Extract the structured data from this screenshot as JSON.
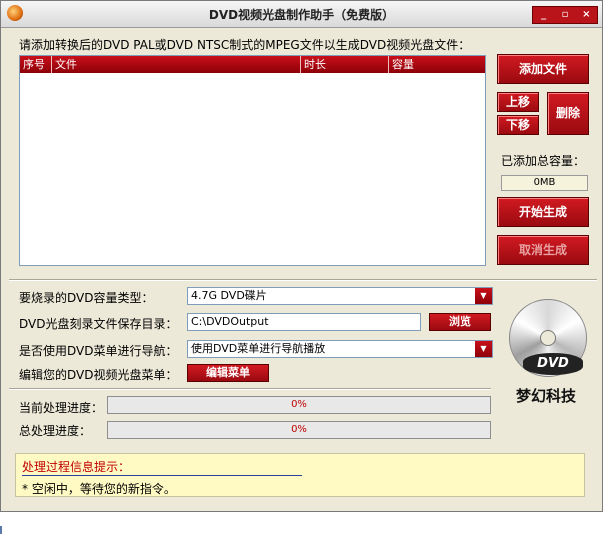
{
  "window": {
    "title": "DVD视频光盘制作助手（免费版）",
    "controls": {
      "minimize": "_",
      "restore": "▫",
      "close": "×"
    }
  },
  "instructions": "请添加转换后的DVD PAL或DVD NTSC制式的MPEG文件以生成DVD视频光盘文件：",
  "file_list": {
    "columns": [
      "序号",
      "文件",
      "时长",
      "容量"
    ],
    "rows": []
  },
  "buttons": {
    "add_file": "添加文件",
    "move_up": "上移",
    "move_down": "下移",
    "delete": "删除",
    "start": "开始生成",
    "cancel": "取消生成",
    "browse": "浏览",
    "edit_menu": "编辑菜单"
  },
  "capacity": {
    "label": "已添加总容量：",
    "value": "0MB"
  },
  "settings": {
    "dvd_type_label": "要烧录的DVD容量类型：",
    "dvd_type_value": "4.7G DVD碟片",
    "save_dir_label": "DVD光盘刻录文件保存目录：",
    "save_dir_value": "C:\\DVDOutput",
    "menu_nav_label": "是否使用DVD菜单进行导航：",
    "menu_nav_value": "使用DVD菜单进行导航播放",
    "edit_menu_label": "编辑您的DVD视频光盘菜单："
  },
  "progress": {
    "current_label": "当前处理进度：",
    "current_text": "0%",
    "current_fraction": 0,
    "total_label": "总处理进度：",
    "total_text": "0%",
    "total_fraction": 0
  },
  "logo": {
    "disc_text": "DVD",
    "company": "梦幻科技"
  },
  "info": {
    "title": "处理过程信息提示：",
    "message": "* 空闲中，等待您的新指令。"
  },
  "colors": {
    "accent_red": "#b8141a",
    "info_bg": "#fff9c4",
    "info_title": "#c00000"
  }
}
